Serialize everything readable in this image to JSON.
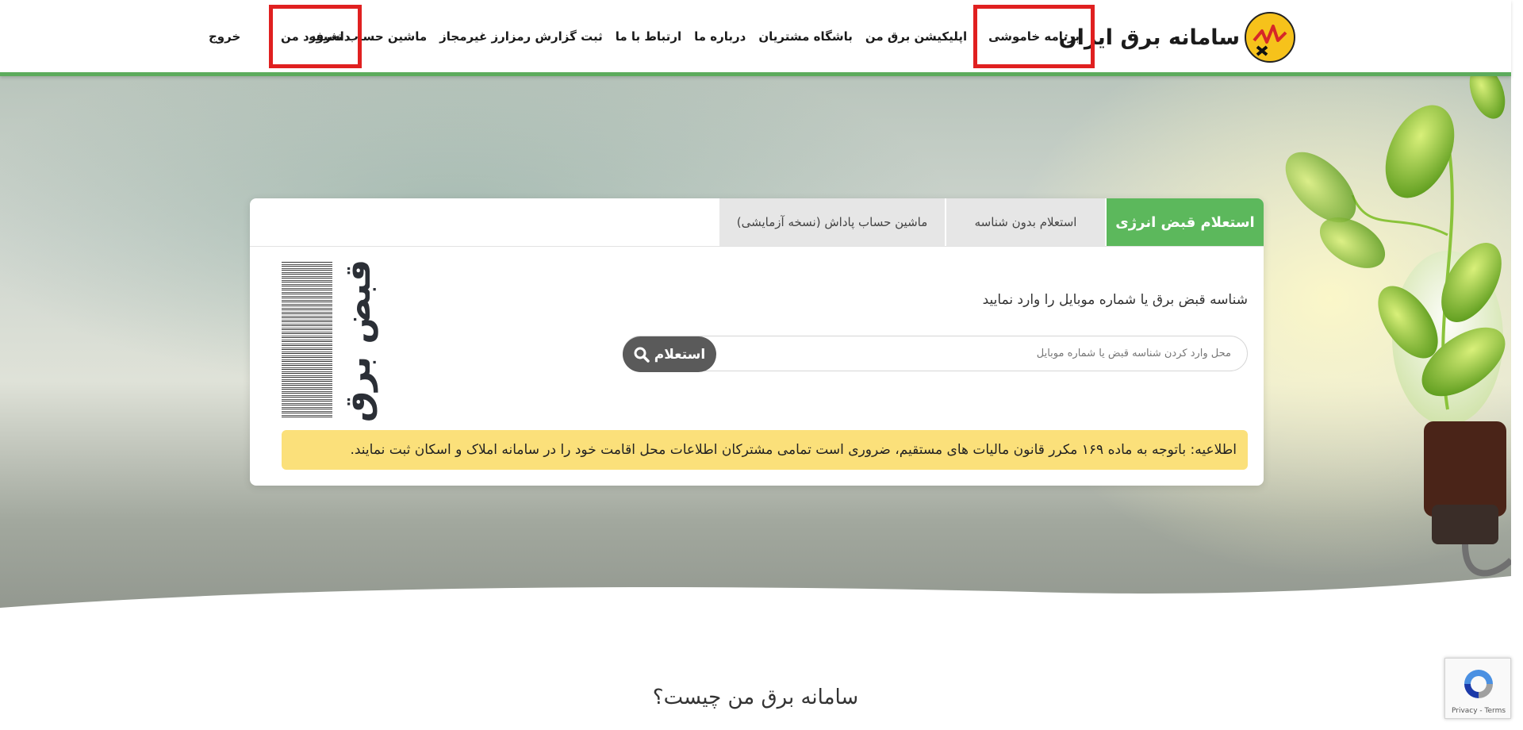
{
  "header": {
    "brand_name": "سامانه برق ایران",
    "nav": [
      "برنامه خاموشی",
      "اپلیکیشن برق من",
      "باشگاه مشتریان",
      "درباره ما",
      "ارتباط با ما",
      "ثبت گزارش رمزارز غیرمجاز",
      "ماشین حساب تعرفه"
    ],
    "dashboard": "داشبورد من",
    "logout": "خروج",
    "accent_color": "#5cab5c",
    "highlight_color": "#e02020"
  },
  "card": {
    "tabs": [
      {
        "label": "استعلام قبض انرژی",
        "active": true
      },
      {
        "label": "استعلام بدون شناسه",
        "active": false
      },
      {
        "label": "ماشین حساب پاداش (نسخه آزمایشی)",
        "active": false
      }
    ],
    "instruction": "شناسه قبض برق یا شماره موبایل را وارد نمایید",
    "search_placeholder": "محل وارد کردن شناسه قبض یا شماره موبایل",
    "search_value": "",
    "search_button": "استعلام",
    "logo_text": "قبض برق",
    "notice": "اطلاعیه: باتوجه به ماده ۱۶۹ مکرر قانون مالیات های مستقیم، ضروری است تمامی مشترکان اطلاعات محل اقامت خود را در سامانه املاک و اسکان ثبت نمایند.",
    "tab_active_color": "#5cb85c",
    "notice_color": "#fbe07a"
  },
  "section": {
    "title": "سامانه برق من چیست؟"
  },
  "recaptcha": {
    "links": "Privacy - Terms"
  }
}
